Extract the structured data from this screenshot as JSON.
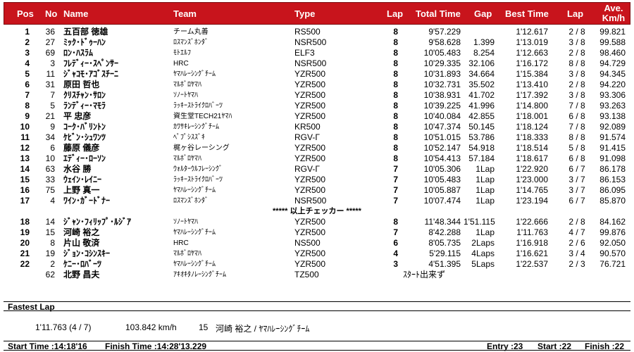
{
  "header": {
    "pos": "Pos",
    "no": "No",
    "name": "Name",
    "team": "Team",
    "type": "Type",
    "lap": "Lap",
    "total_time": "Total Time",
    "gap": "Gap",
    "best_time": "Best Time",
    "best_lap": "Lap",
    "ave_line1": "Ave.",
    "ave_line2": "Km/h"
  },
  "results": [
    {
      "pos": "1",
      "no": "36",
      "name": "五百部 徳雄",
      "team": "チーム丸善",
      "type": "RS500",
      "lap": "8",
      "total": "9'57.229",
      "gap": "",
      "best": "1'12.617",
      "blap": "2 / 8",
      "ave": "99.821"
    },
    {
      "pos": "2",
      "no": "27",
      "name": "ﾐｯｸ･ﾄﾞｩｰﾊﾝ",
      "team": "ﾛｽﾏﾝｽﾞﾎﾝﾀﾞ",
      "type": "NSR500",
      "lap": "8",
      "total": "9'58.628",
      "gap": "1.399",
      "best": "1'13.019",
      "blap": "3 / 8",
      "ave": "99.588"
    },
    {
      "pos": "3",
      "no": "69",
      "name": "ﾛﾝ･ﾊｽﾗﾑ",
      "team": "ﾓﾄｴﾙﾌ",
      "type": "ELF3",
      "lap": "8",
      "total": "10'05.483",
      "gap": "8.254",
      "best": "1'12.663",
      "blap": "2 / 8",
      "ave": "98.460"
    },
    {
      "pos": "4",
      "no": "3",
      "name": "ﾌﾚﾃﾞｨｰ･ｽﾍﾟﾝｻｰ",
      "team": "HRC",
      "type": "NSR500",
      "lap": "8",
      "total": "10'29.335",
      "gap": "32.106",
      "best": "1'16.172",
      "blap": "8 / 8",
      "ave": "94.729"
    },
    {
      "pos": "5",
      "no": "11",
      "name": "ｼﾞｬｺﾓ･ｱｺﾞｽﾁｰﾆ",
      "team": "ﾔﾏﾊﾚｰｼﾝｸﾞﾁｰﾑ",
      "type": "YZR500",
      "lap": "8",
      "total": "10'31.893",
      "gap": "34.664",
      "best": "1'15.384",
      "blap": "3 / 8",
      "ave": "94.345"
    },
    {
      "pos": "6",
      "no": "31",
      "name": "原田 哲也",
      "team": "ﾏﾙﾎﾞﾛﾔﾏﾊ",
      "type": "YZR500",
      "lap": "8",
      "total": "10'32.731",
      "gap": "35.502",
      "best": "1'13.410",
      "blap": "2 / 8",
      "ave": "94.220"
    },
    {
      "pos": "7",
      "no": "7",
      "name": "ｸﾘｽﾁｬﾝ･ｻﾛﾝ",
      "team": "ｿﾉｰﾄﾔﾏﾊ",
      "type": "YZR500",
      "lap": "8",
      "total": "10'38.931",
      "gap": "41.702",
      "best": "1'17.392",
      "blap": "3 / 8",
      "ave": "93.306"
    },
    {
      "pos": "8",
      "no": "5",
      "name": "ﾗﾝﾃﾞｨｰ･ﾏﾓﾗ",
      "team": "ﾗｯｷｰｽﾄﾗｲｸﾛﾊﾞｰﾂ",
      "type": "YZR500",
      "lap": "8",
      "total": "10'39.225",
      "gap": "41.996",
      "best": "1'14.800",
      "blap": "7 / 8",
      "ave": "93.263"
    },
    {
      "pos": "9",
      "no": "21",
      "name": "平 忠彦",
      "team": "資生堂TECH21ﾔﾏﾊ",
      "type": "YZR500",
      "lap": "8",
      "total": "10'40.084",
      "gap": "42.855",
      "best": "1'18.001",
      "blap": "6 / 8",
      "ave": "93.138"
    },
    {
      "pos": "10",
      "no": "9",
      "name": "ｺｰｸ･ﾊﾞﾘﾝﾄﾝ",
      "team": "ｶﾜｻｷﾚｰｼﾝｸﾞﾁｰﾑ",
      "type": "KR500",
      "lap": "8",
      "total": "10'47.374",
      "gap": "50.145",
      "best": "1'18.124",
      "blap": "7 / 8",
      "ave": "92.089"
    },
    {
      "pos": "11",
      "no": "34",
      "name": "ｹﾋﾞﾝ･ｼｭﾜﾝﾂ",
      "team": "ﾍﾟﾌﾟｼｽｽﾞｷ",
      "type": "RGV-Γ",
      "lap": "8",
      "total": "10'51.015",
      "gap": "53.786",
      "best": "1'18.333",
      "blap": "8 / 8",
      "ave": "91.574"
    },
    {
      "pos": "12",
      "no": "6",
      "name": "藤原 儀彦",
      "team": "梶ヶ谷レーシング",
      "type": "YZR500",
      "lap": "8",
      "total": "10'52.147",
      "gap": "54.918",
      "best": "1'18.514",
      "blap": "5 / 8",
      "ave": "91.415"
    },
    {
      "pos": "13",
      "no": "10",
      "name": "ｴﾃﾞｨｰ･ﾛｰｿﾝ",
      "team": "ﾏﾙﾎﾞﾛﾔﾏﾊ",
      "type": "YZR500",
      "lap": "8",
      "total": "10'54.413",
      "gap": "57.184",
      "best": "1'18.617",
      "blap": "6 / 8",
      "ave": "91.098"
    },
    {
      "pos": "14",
      "no": "63",
      "name": "水谷 勝",
      "team": "ｳｫﾙﾀｰｳﾙﾌﾚｰｼﾝｸﾞ",
      "type": "RGV-Γ",
      "lap": "7",
      "total": "10'05.306",
      "gap": "1Lap",
      "best": "1'22.920",
      "blap": "6 / 7",
      "ave": "86.178"
    },
    {
      "pos": "15",
      "no": "33",
      "name": "ｳｪｲﾝ･ﾚｲﾆｰ",
      "team": "ﾗｯｷｰｽﾄﾗｲｸﾛﾊﾞｰﾂ",
      "type": "YZR500",
      "lap": "7",
      "total": "10'05.483",
      "gap": "1Lap",
      "best": "1'23.000",
      "blap": "3 / 7",
      "ave": "86.153"
    },
    {
      "pos": "16",
      "no": "75",
      "name": "上野 真一",
      "team": "ﾔﾏﾊﾚｰｼﾝｸﾞﾁｰﾑ",
      "type": "YZR500",
      "lap": "7",
      "total": "10'05.887",
      "gap": "1Lap",
      "best": "1'14.765",
      "blap": "3 / 7",
      "ave": "86.095"
    },
    {
      "pos": "17",
      "no": "4",
      "name": "ﾜｲﾝ･ｶﾞｰﾄﾞﾅｰ",
      "team": "ﾛｽﾏﾝｽﾞﾎﾝﾀﾞ",
      "type": "NSR500",
      "lap": "7",
      "total": "10'07.474",
      "gap": "1Lap",
      "best": "1'23.194",
      "blap": "6 / 7",
      "ave": "85.870"
    }
  ],
  "checker_line": "***** 以上チェッカー *****",
  "results_unclassified": [
    {
      "pos": "18",
      "no": "14",
      "name": "ｼﾞｬﾝ･ﾌｨﾘｯﾌﾟ･ﾙｼﾞｱ",
      "team": "ｿﾉｰﾄﾔﾏﾊ",
      "type": "YZR500",
      "lap": "8",
      "total": "11'48.344",
      "gap": "1'51.115",
      "best": "1'22.666",
      "blap": "2 / 8",
      "ave": "84.162"
    },
    {
      "pos": "19",
      "no": "15",
      "name": "河崎 裕之",
      "team": "ﾔﾏﾊﾚｰｼﾝｸﾞﾁｰﾑ",
      "type": "YZR500",
      "lap": "7",
      "total": "8'42.288",
      "gap": "1Lap",
      "best": "1'11.763",
      "blap": "4 / 7",
      "ave": "99.876"
    },
    {
      "pos": "20",
      "no": "8",
      "name": "片山 敬済",
      "team": "HRC",
      "type": "NS500",
      "lap": "6",
      "total": "8'05.735",
      "gap": "2Laps",
      "best": "1'16.918",
      "blap": "2 / 6",
      "ave": "92.050"
    },
    {
      "pos": "21",
      "no": "19",
      "name": "ｼﾞｮﾝ･ｺｼﾝｽｷｰ",
      "team": "ﾏﾙﾎﾞﾛﾔﾏﾊ",
      "type": "YZR500",
      "lap": "4",
      "total": "5'29.115",
      "gap": "4Laps",
      "best": "1'16.621",
      "blap": "3 / 4",
      "ave": "90.570"
    },
    {
      "pos": "22",
      "no": "2",
      "name": "ｹﾆｰ･ﾛﾊﾞｰﾂ",
      "team": "ﾔﾏﾊﾚｰｼﾝｸﾞﾁｰﾑ",
      "type": "YZR500",
      "lap": "3",
      "total": "4'51.395",
      "gap": "5Laps",
      "best": "1'22.537",
      "blap": "2 / 3",
      "ave": "76.721"
    },
    {
      "pos": "",
      "no": "62",
      "name": "北野 昌夫",
      "team": "ｱｷｵｷﾀﾉﾚｰｼﾝｸﾞﾁｰﾑ",
      "type": "TZ500",
      "lap": "",
      "total": "ｽﾀｰﾄ出来ず",
      "gap": "",
      "best": "",
      "blap": "",
      "ave": ""
    }
  ],
  "fastest_lap": {
    "title": "Fastest Lap",
    "time": "1'11.763 (4 / 7)",
    "speed": "103.842 km/h",
    "no": "15",
    "rider_team": "河崎 裕之 / ﾔﾏﾊﾚｰｼﾝｸﾞﾁｰﾑ"
  },
  "footer": {
    "start_time": "Start Time :14:18'16",
    "finish_time": "Finish Time :14:28'13.229",
    "entry": "Entry :23",
    "start": "Start :22",
    "finish": "Finish :22"
  },
  "colors": {
    "header_bg": "#c8141c",
    "header_text": "#ffffff"
  }
}
